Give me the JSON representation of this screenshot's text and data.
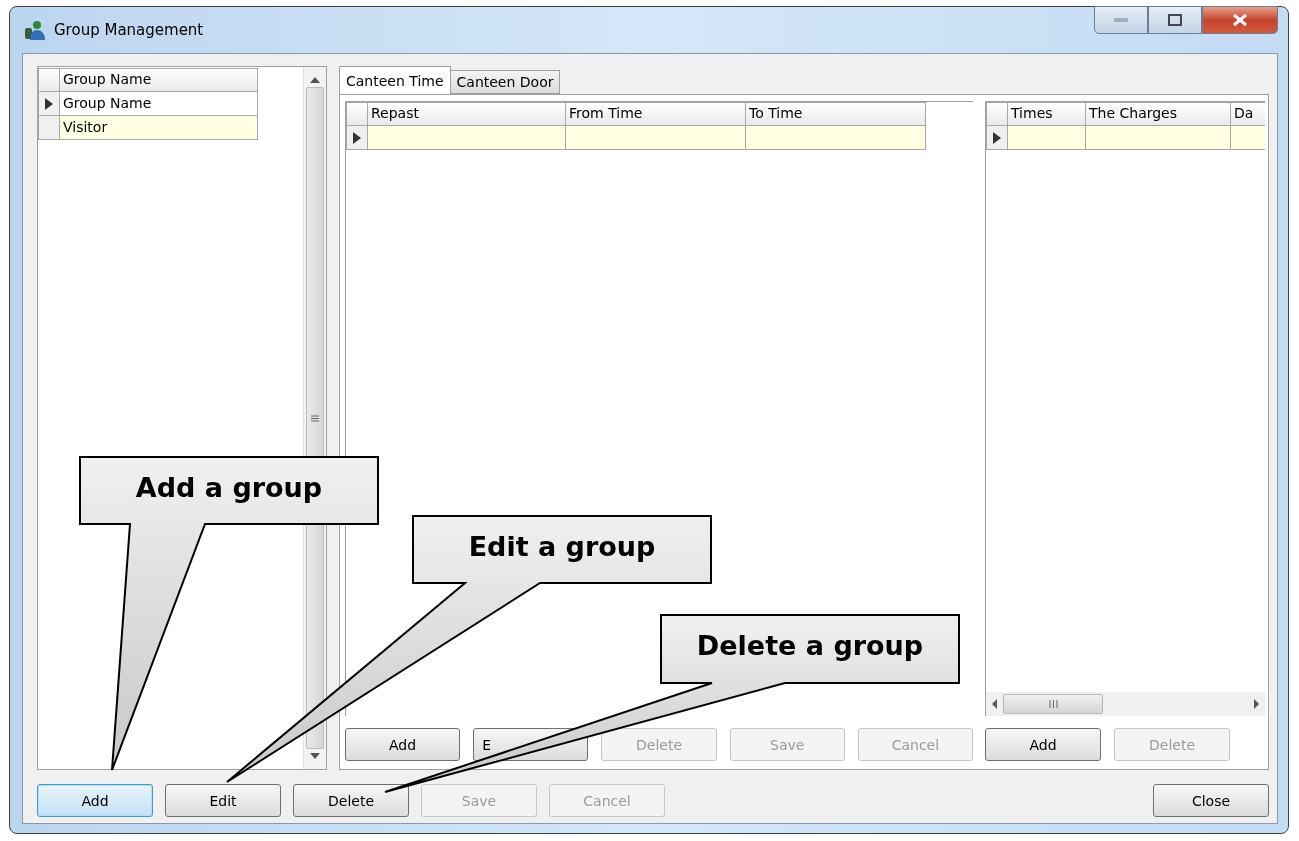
{
  "window": {
    "title": "Group Management"
  },
  "group_grid": {
    "columns": [
      "Group Name"
    ],
    "rows": [
      {
        "name": "Group Name",
        "selected": true,
        "highlighted": false
      },
      {
        "name": "Visitor",
        "selected": false,
        "highlighted": true
      }
    ]
  },
  "tabs": [
    {
      "label": "Canteen Time",
      "selected": true
    },
    {
      "label": "Canteen Door",
      "selected": false
    }
  ],
  "time_grid": {
    "columns": [
      "Repast",
      "From Time",
      "To Time"
    ],
    "rows": [
      {
        "selected": true
      }
    ]
  },
  "time_buttons": [
    {
      "label": "Add",
      "disabled": false
    },
    {
      "label": "E",
      "disabled": false,
      "covered": true
    },
    {
      "label": "Delete",
      "disabled": true
    },
    {
      "label": "Save",
      "disabled": true
    },
    {
      "label": "Cancel",
      "disabled": true
    }
  ],
  "charges_grid": {
    "columns": [
      "Times",
      "The Charges",
      "Da"
    ],
    "rows": [
      {
        "selected": true
      }
    ]
  },
  "charges_buttons": [
    {
      "label": "Add",
      "disabled": false
    },
    {
      "label": "Delete",
      "disabled": true
    }
  ],
  "bottom_buttons": [
    {
      "label": "Add",
      "disabled": false,
      "focused": true
    },
    {
      "label": "Edit",
      "disabled": false,
      "focused": false
    },
    {
      "label": "Delete",
      "disabled": false,
      "focused": false
    },
    {
      "label": "Save",
      "disabled": true,
      "focused": false
    },
    {
      "label": "Cancel",
      "disabled": true,
      "focused": false
    }
  ],
  "close_button": {
    "label": "Close"
  },
  "callouts": [
    {
      "text": "Add a group"
    },
    {
      "text": "Edit a group"
    },
    {
      "text": "Delete a group"
    }
  ]
}
